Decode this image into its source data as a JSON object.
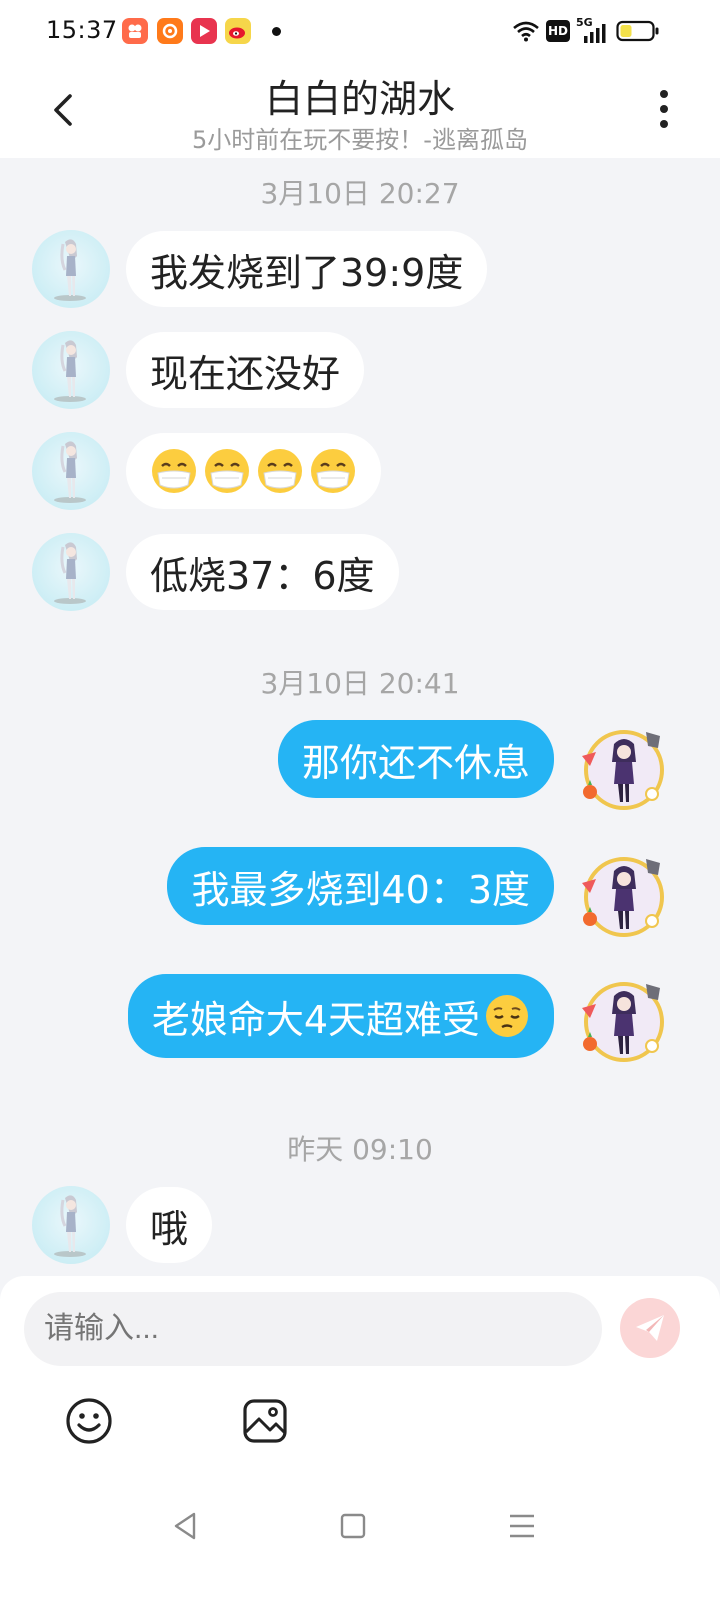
{
  "status_bar": {
    "time": "15:37",
    "apps": [
      {
        "name": "kuaishou-app-icon",
        "color": "#ff6b4a"
      },
      {
        "name": "orange-app-icon",
        "color": "#ff7a1a"
      },
      {
        "name": "video-app-icon",
        "color": "#e8344f"
      },
      {
        "name": "weibo-app-icon",
        "color": "#f6a623"
      }
    ],
    "hd_label": "HD",
    "network_label": "5G",
    "icons": [
      "wifi-icon",
      "hd-icon",
      "signal-icon",
      "battery-icon"
    ]
  },
  "header": {
    "title": "白白的湖水",
    "subtitle": "5小时前在玩不要按！-逃离孤岛"
  },
  "chat": {
    "timestamps": [
      "3月10日 20:27",
      "3月10日 20:41",
      "昨天 09:10"
    ],
    "incoming": [
      {
        "text": "我发烧到了39:9度"
      },
      {
        "text": "现在还没好"
      },
      {
        "text": "",
        "emoji": "mask-face-emoji",
        "emoji_count": 4
      },
      {
        "text": "低烧37：6度"
      },
      {
        "text": "哦"
      }
    ],
    "outgoing": [
      {
        "text": "那你还不休息"
      },
      {
        "text": "我最多烧到40：3度"
      },
      {
        "text": "老娘命大4天超难受",
        "emoji": "pensive-face-emoji"
      }
    ]
  },
  "input": {
    "placeholder": "请输入..."
  },
  "colors": {
    "accent": "#25b4f4",
    "background": "#f3f4f7",
    "send_disabled": "#fbd6d6"
  }
}
